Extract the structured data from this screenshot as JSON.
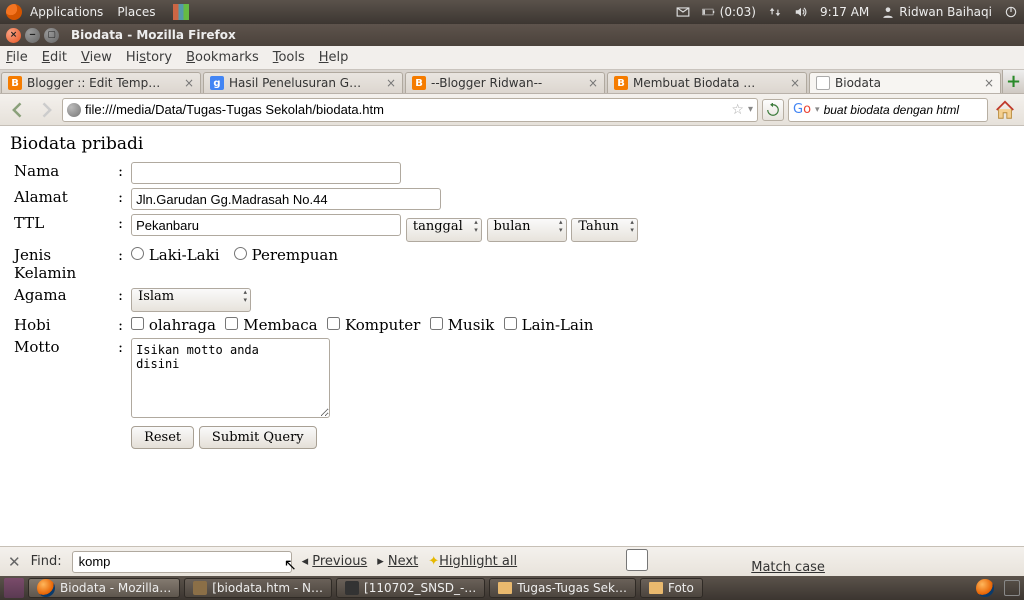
{
  "sys": {
    "applications": "Applications",
    "places": "Places",
    "battery": "(0:03)",
    "time": "9:17 AM",
    "user": "Ridwan Baihaqi"
  },
  "window": {
    "title": "Biodata - Mozilla Firefox"
  },
  "menus": {
    "file": "File",
    "edit": "Edit",
    "view": "View",
    "history": "History",
    "bookmarks": "Bookmarks",
    "tools": "Tools",
    "help": "Help"
  },
  "tabs": [
    {
      "label": "Blogger :: Edit Temp…",
      "fav": "blogger"
    },
    {
      "label": "Hasil Penelusuran G…",
      "fav": "google"
    },
    {
      "label": "--Blogger Ridwan--",
      "fav": "blogger"
    },
    {
      "label": "Membuat Biodata …",
      "fav": "blogger"
    },
    {
      "label": "Biodata",
      "fav": "page",
      "active": true
    }
  ],
  "url": "file:///media/Data/Tugas-Tugas Sekolah/biodata.htm",
  "search": "buat biodata dengan html",
  "form": {
    "heading": "Biodata pribadi",
    "labels": {
      "nama": "Nama",
      "alamat": "Alamat",
      "ttl": "TTL",
      "jk": "Jenis Kelamin",
      "agama": "Agama",
      "hobi": "Hobi",
      "motto": "Motto"
    },
    "nama_value": "",
    "alamat_value": "Jln.Garudan Gg.Madrasah No.44",
    "ttl_value": "Pekanbaru",
    "tgl": "tanggal",
    "bln": "bulan",
    "thn": "Tahun",
    "jk_laki": "Laki-Laki",
    "jk_perempuan": "Perempuan",
    "agama_value": "Islam",
    "hobi": {
      "olahraga": "olahraga",
      "membaca": "Membaca",
      "komputer": "Komputer",
      "musik": "Musik",
      "lain": "Lain-Lain"
    },
    "motto_value": "Isikan motto anda\ndisini",
    "reset": "Reset",
    "submit": "Submit Query"
  },
  "find": {
    "label": "Find:",
    "value": "komp",
    "prev": "Previous",
    "next": "Next",
    "highlight": "Highlight all",
    "matchcase": "Match case"
  },
  "taskbar": [
    "Biodata - Mozilla…",
    "[biodata.htm - N…",
    "[110702_SNSD_-…",
    "Tugas-Tugas Sek…",
    "Foto"
  ]
}
